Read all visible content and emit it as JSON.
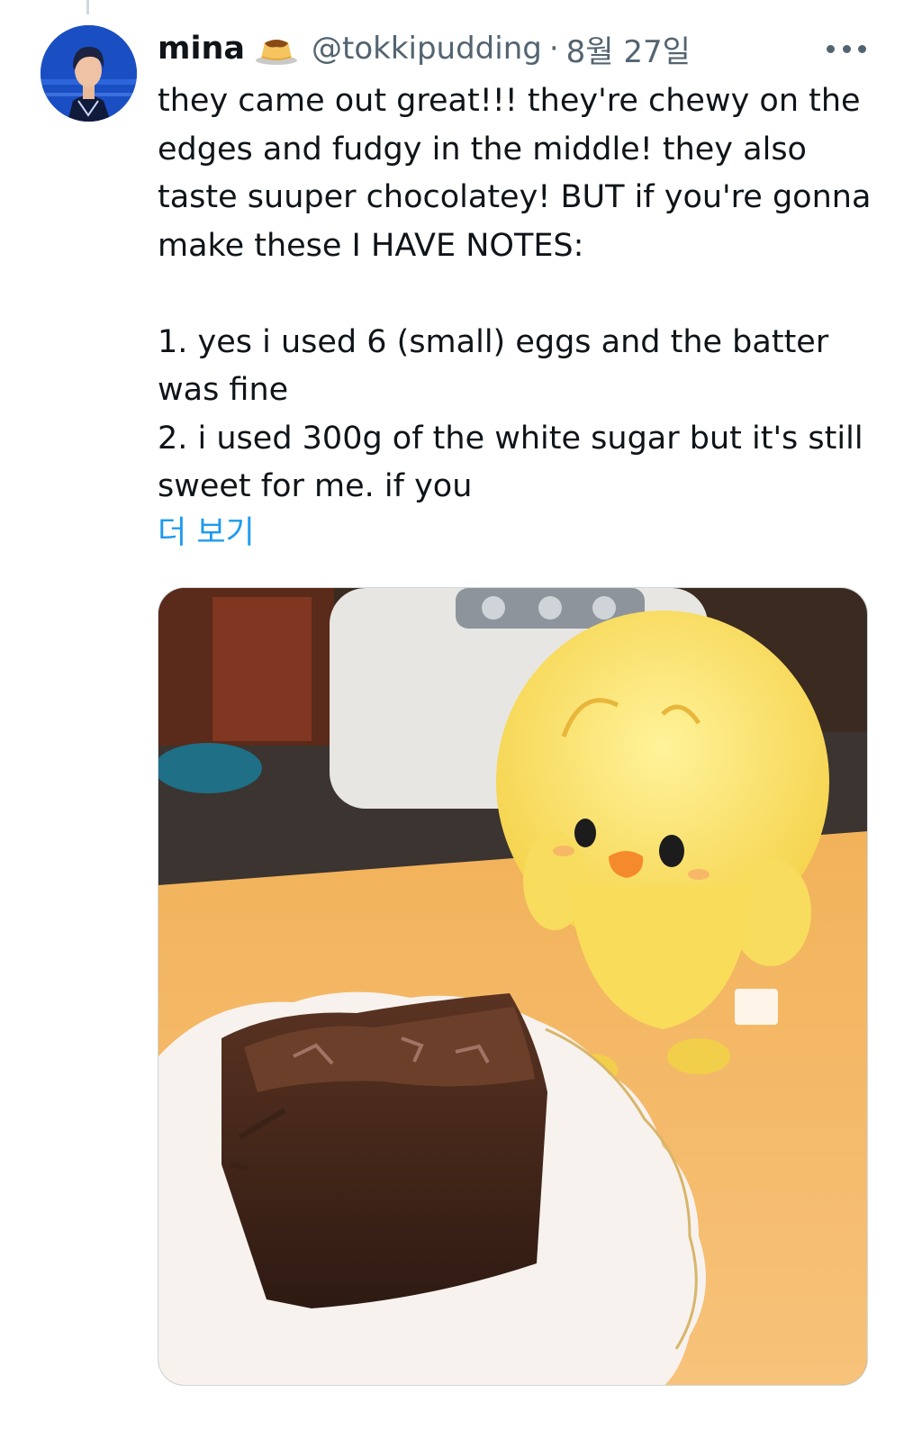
{
  "tweet": {
    "author": {
      "display_name": "mina",
      "name_emoji": "custard-pudding-emoji",
      "handle": "@tokkipudding",
      "avatar_icon": "profile-avatar"
    },
    "separator": "·",
    "date": "8월 27일",
    "more_icon": "more-dots-icon",
    "text": {
      "paragraph1": "they came out great!!! they're chewy on the edges and fudgy in the middle! they also taste suuper chocolatey! BUT if you're gonna make these I HAVE NOTES:",
      "note1": "1. yes i used 6 (small) eggs and the batter was fine",
      "note2": "2. i used 300g of the white sugar but it's still sweet for me. if you"
    },
    "show_more": "더 보기",
    "media": {
      "type": "photo",
      "content": "brownie-on-plate-with-yellow-chick-plush"
    }
  },
  "colors": {
    "text_primary": "#0f1419",
    "text_secondary": "#536471",
    "link": "#1d9bf0",
    "border": "#cfd9de"
  }
}
